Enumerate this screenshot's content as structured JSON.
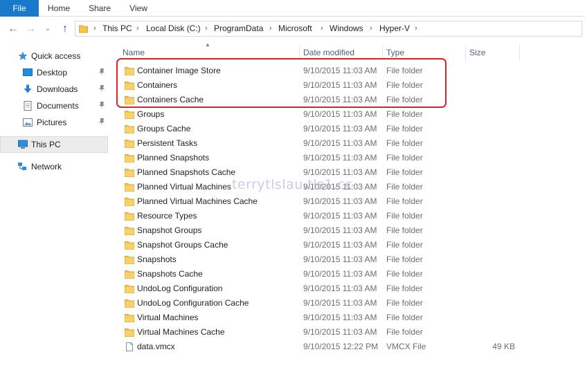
{
  "ribbon": {
    "tabs": [
      {
        "label": "File"
      },
      {
        "label": "Home"
      },
      {
        "label": "Share"
      },
      {
        "label": "View"
      }
    ]
  },
  "address": {
    "breadcrumbs": [
      "This PC",
      "Local Disk (C:)",
      "ProgramData",
      "Microsoft",
      "Windows",
      "Hyper-V"
    ]
  },
  "sidebar": {
    "items": [
      {
        "label": "Quick access",
        "icon": "star-icon"
      },
      {
        "label": "Desktop",
        "icon": "desktop-icon",
        "pinned": true
      },
      {
        "label": "Downloads",
        "icon": "download-icon",
        "pinned": true
      },
      {
        "label": "Documents",
        "icon": "documents-icon",
        "pinned": true
      },
      {
        "label": "Pictures",
        "icon": "pictures-icon",
        "pinned": true
      },
      {
        "label": "This PC",
        "icon": "computer-icon",
        "selected": true
      },
      {
        "label": "Network",
        "icon": "network-icon"
      }
    ]
  },
  "columns": {
    "name": "Name",
    "date": "Date modified",
    "type": "Type",
    "size": "Size"
  },
  "files": [
    {
      "name": "Container Image Store",
      "date": "9/10/2015 11:03 AM",
      "type": "File folder",
      "size": ""
    },
    {
      "name": "Containers",
      "date": "9/10/2015 11:03 AM",
      "type": "File folder",
      "size": ""
    },
    {
      "name": "Containers Cache",
      "date": "9/10/2015 11:03 AM",
      "type": "File folder",
      "size": ""
    },
    {
      "name": "Groups",
      "date": "9/10/2015 11:03 AM",
      "type": "File folder",
      "size": ""
    },
    {
      "name": "Groups Cache",
      "date": "9/10/2015 11:03 AM",
      "type": "File folder",
      "size": ""
    },
    {
      "name": "Persistent Tasks",
      "date": "9/10/2015 11:03 AM",
      "type": "File folder",
      "size": ""
    },
    {
      "name": "Planned Snapshots",
      "date": "9/10/2015 11:03 AM",
      "type": "File folder",
      "size": ""
    },
    {
      "name": "Planned Snapshots Cache",
      "date": "9/10/2015 11:03 AM",
      "type": "File folder",
      "size": ""
    },
    {
      "name": "Planned Virtual Machines",
      "date": "9/10/2015 11:03 AM",
      "type": "File folder",
      "size": ""
    },
    {
      "name": "Planned Virtual Machines Cache",
      "date": "9/10/2015 11:03 AM",
      "type": "File folder",
      "size": ""
    },
    {
      "name": "Resource Types",
      "date": "9/10/2015 11:03 AM",
      "type": "File folder",
      "size": ""
    },
    {
      "name": "Snapshot Groups",
      "date": "9/10/2015 11:03 AM",
      "type": "File folder",
      "size": ""
    },
    {
      "name": "Snapshot Groups Cache",
      "date": "9/10/2015 11:03 AM",
      "type": "File folder",
      "size": ""
    },
    {
      "name": "Snapshots",
      "date": "9/10/2015 11:03 AM",
      "type": "File folder",
      "size": ""
    },
    {
      "name": "Snapshots Cache",
      "date": "9/10/2015 11:03 AM",
      "type": "File folder",
      "size": ""
    },
    {
      "name": "UndoLog Configuration",
      "date": "9/10/2015 11:03 AM",
      "type": "File folder",
      "size": ""
    },
    {
      "name": "UndoLog Configuration Cache",
      "date": "9/10/2015 11:03 AM",
      "type": "File folder",
      "size": ""
    },
    {
      "name": "Virtual Machines",
      "date": "9/10/2015 11:03 AM",
      "type": "File folder",
      "size": ""
    },
    {
      "name": "Virtual Machines Cache",
      "date": "9/10/2015 11:03 AM",
      "type": "File folder",
      "size": ""
    },
    {
      "name": "data.vmcx",
      "date": "9/10/2015 12:22 PM",
      "type": "VMCX File",
      "size": "49 KB",
      "is_file": true
    }
  ],
  "watermark": "terrytlslau.tls1.cc",
  "colors": {
    "file_tab": "#1979ca",
    "folder": "#f1c550",
    "highlight": "#e0202a"
  }
}
